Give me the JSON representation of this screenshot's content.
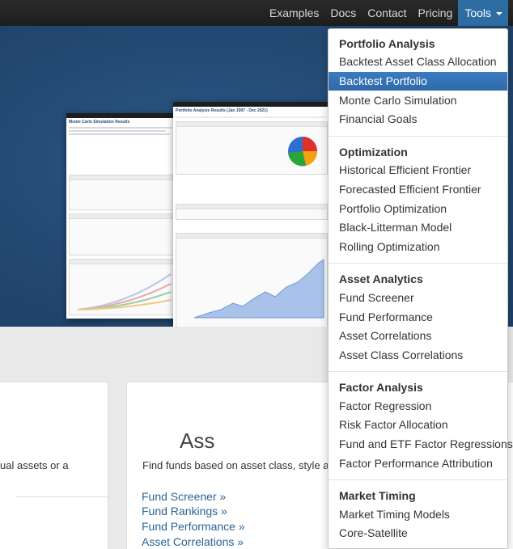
{
  "nav": {
    "links": [
      "Examples",
      "Docs",
      "Contact",
      "Pricing"
    ],
    "tools_label": "Tools"
  },
  "hero": {
    "shot1_title": "Monte Carlo Simulation Results",
    "shot2_title": "Portfolio Analysis Results (Jan 1997 - Dec 2021)"
  },
  "cards": {
    "left_text": "ual assets or a",
    "mid_heading": "Ass",
    "mid_text": "Find funds based on asset class, style and",
    "links": [
      "Fund Screener »",
      "Fund Rankings »",
      "Fund Performance »",
      "Asset Correlations »"
    ]
  },
  "dropdown": {
    "sections": [
      {
        "header": "Portfolio Analysis",
        "items": [
          "Backtest Asset Class Allocation",
          "Backtest Portfolio",
          "Monte Carlo Simulation",
          "Financial Goals"
        ]
      },
      {
        "header": "Optimization",
        "items": [
          "Historical Efficient Frontier",
          "Forecasted Efficient Frontier",
          "Portfolio Optimization",
          "Black-Litterman Model",
          "Rolling Optimization"
        ]
      },
      {
        "header": "Asset Analytics",
        "items": [
          "Fund Screener",
          "Fund Performance",
          "Asset Correlations",
          "Asset Class Correlations"
        ]
      },
      {
        "header": "Factor Analysis",
        "items": [
          "Factor Regression",
          "Risk Factor Allocation",
          "Fund and ETF Factor Regressions",
          "Factor Performance Attribution"
        ]
      },
      {
        "header": "Market Timing",
        "items": [
          "Market Timing Models",
          "Core-Satellite"
        ]
      }
    ],
    "active_item": "Backtest Portfolio"
  },
  "colors": {
    "navbar": "#1d1d1d",
    "hero": "#234872",
    "accent": "#2e6da4",
    "link": "#2a6496"
  }
}
